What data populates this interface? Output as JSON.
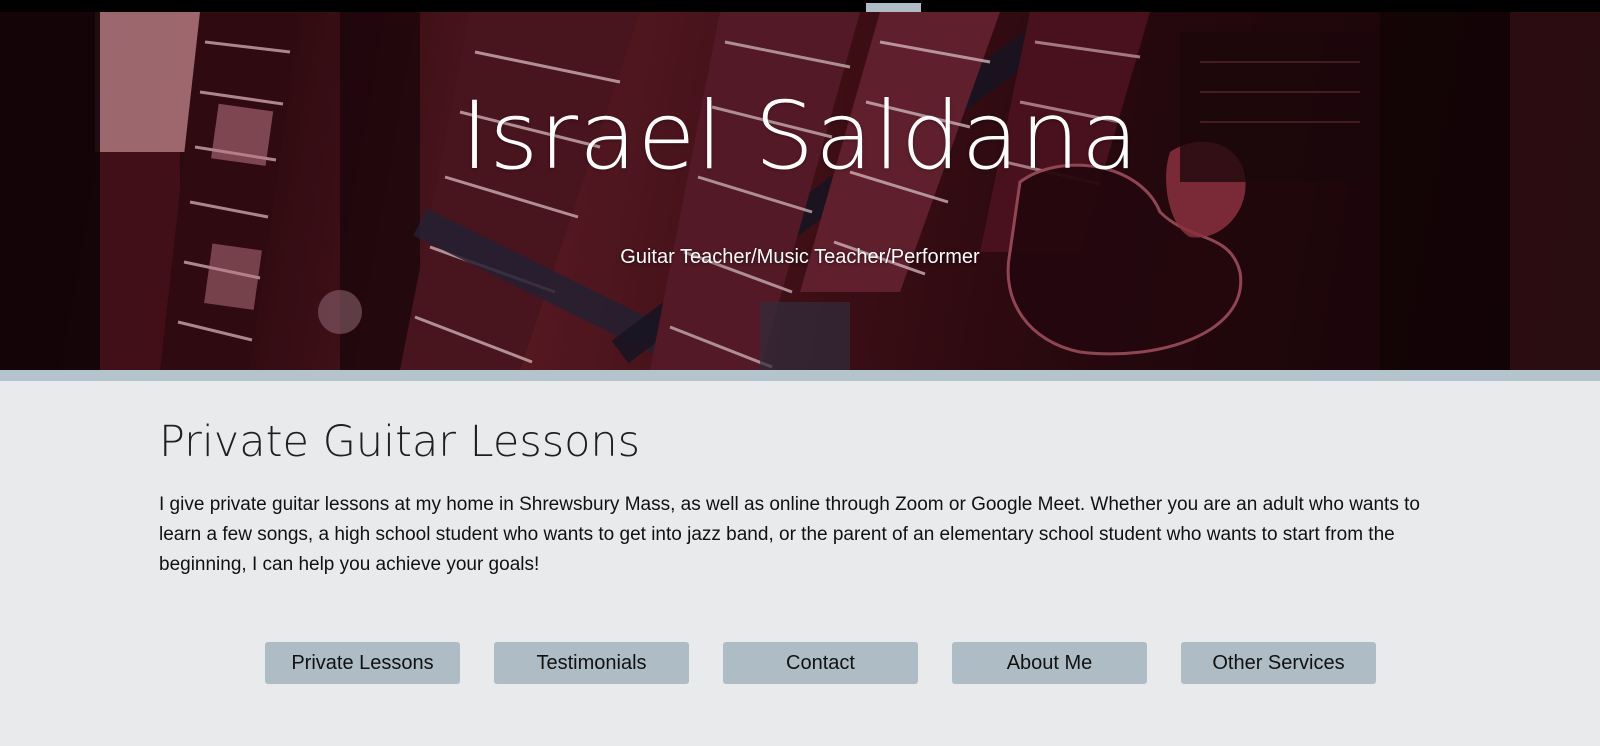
{
  "hero": {
    "title": "Israel Saldana",
    "subtitle": "Guitar Teacher/Music Teacher/Performer",
    "image_subject": "electric guitars on stands, red-tinted photo"
  },
  "main": {
    "heading": "Private Guitar Lessons",
    "body": "I give private guitar lessons at my home in Shrewsbury Mass, as well as online through Zoom or Google Meet. Whether you are an adult who wants to learn a few songs, a high school student who wants to get into jazz band, or the parent of an elementary school student who wants to start from the beginning, I can help you achieve your goals!"
  },
  "nav": {
    "buttons": [
      {
        "label": "Private Lessons"
      },
      {
        "label": "Testimonials"
      },
      {
        "label": "Contact"
      },
      {
        "label": "About Me"
      },
      {
        "label": "Other Services"
      }
    ]
  },
  "colors": {
    "accent": "#aebdc5",
    "background": "#e8eaec",
    "top_bar": "#000000"
  }
}
